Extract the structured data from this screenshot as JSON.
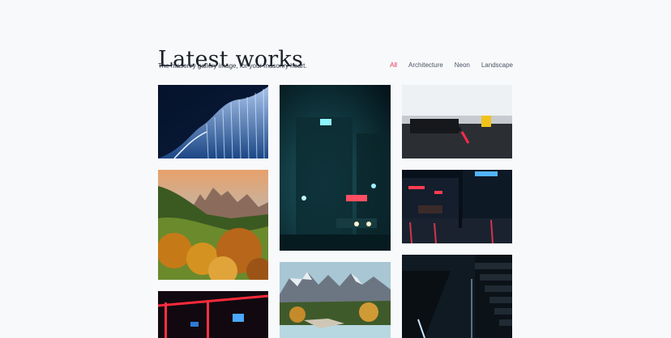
{
  "header": {
    "title": "Latest works",
    "subtitle": "The masonry gallery image, for your masonry heart."
  },
  "filters": [
    {
      "label": "All",
      "active": true
    },
    {
      "label": "Architecture",
      "active": false
    },
    {
      "label": "Neon",
      "active": false
    },
    {
      "label": "Landscape",
      "active": false
    }
  ],
  "colors": {
    "accent": "#e53950",
    "background": "#f8f9fb",
    "title": "#1c2128"
  },
  "gallery": {
    "images": [
      {
        "name": "curved-glass-architecture-image"
      },
      {
        "name": "dolomites-autumn-landscape-image"
      },
      {
        "name": "red-neon-interior-image"
      },
      {
        "name": "foggy-neon-street-image"
      },
      {
        "name": "mountain-lake-landscape-image"
      },
      {
        "name": "white-gallery-interior-image"
      },
      {
        "name": "rainy-neon-city-image"
      },
      {
        "name": "dark-staircase-image"
      }
    ]
  }
}
